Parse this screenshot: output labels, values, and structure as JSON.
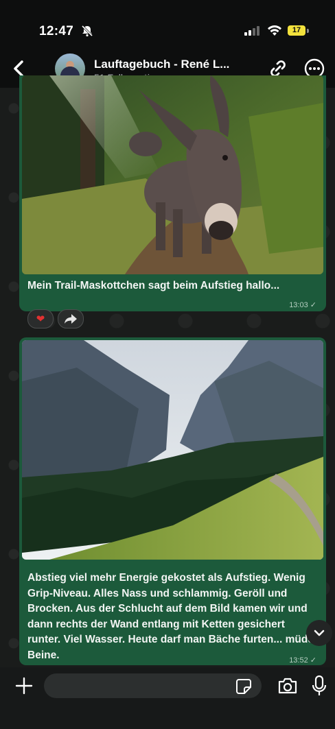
{
  "status_bar": {
    "time": "12:47",
    "battery": "17",
    "icons": [
      "bell-slash-icon",
      "signal-icon",
      "wifi-icon",
      "battery-icon"
    ]
  },
  "header": {
    "title": "Lauftagebuch - René L...",
    "subtitle": "51 Follower*innen",
    "icons": [
      "back-icon",
      "link-icon",
      "more-icon"
    ]
  },
  "messages": [
    {
      "caption": "Mein Trail-Maskottchen sagt beim Aufstieg hallo...",
      "time": "13:03",
      "status_icon": "check-icon",
      "reactions": [
        "heart-icon",
        "forward-icon"
      ]
    },
    {
      "caption": "Abstieg viel mehr Energie gekostet als Aufstieg. Wenig Grip-Niveau. Alles Nass und schlammig. Geröll und Brocken. Aus der Schlucht auf dem Bild kamen wir und dann rechts der Wand entlang mit Ketten gesichert runter. Viel Wasser. Heute darf man Bäche furten... müde Beine.",
      "time": "13:52",
      "status_icon": "check-icon"
    }
  ],
  "composer": {
    "input_value": "",
    "icons": [
      "plus-icon",
      "sticker-icon",
      "camera-icon",
      "microphone-icon"
    ]
  },
  "colors": {
    "bubble": "#1c5a3b",
    "background": "#0c0d0e",
    "heart": "#e23131"
  }
}
